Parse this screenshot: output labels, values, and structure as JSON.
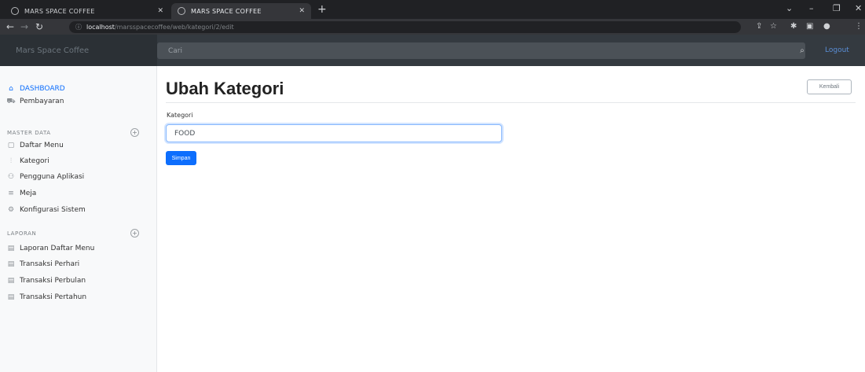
{
  "browser": {
    "tabs": [
      {
        "title": "MARS SPACE COFFEE",
        "active": false
      },
      {
        "title": "MARS SPACE COFFEE",
        "active": true
      }
    ],
    "url_host": "localhost",
    "url_path": "/marsspacecoffee/web/kategori/2/edit",
    "new_tab_symbol": "+",
    "window_controls": [
      "⌄",
      "–",
      "❐",
      "✕"
    ]
  },
  "navbar": {
    "brand": "Mars Space Coffee",
    "search_placeholder": "Cari",
    "signout": "Logout"
  },
  "sidebar": {
    "items": [
      {
        "label": "DASHBOARD",
        "icon": "home-icon",
        "active": true
      },
      {
        "label": "Pembayaran",
        "icon": "cart-icon",
        "active": false
      }
    ],
    "sections": [
      {
        "heading": "MASTER DATA",
        "items": [
          {
            "label": "Daftar Menu",
            "icon": "file-icon"
          },
          {
            "label": "Kategori",
            "icon": "bar-chart-icon"
          },
          {
            "label": "Pengguna Aplikasi",
            "icon": "users-icon"
          },
          {
            "label": "Meja",
            "icon": "layers-icon"
          },
          {
            "label": "Konfigurasi Sistem",
            "icon": "gear-icon"
          }
        ]
      },
      {
        "heading": "LAPORAN",
        "items": [
          {
            "label": "Laporan Daftar Menu",
            "icon": "document-icon"
          },
          {
            "label": "Transaksi Perhari",
            "icon": "document-icon"
          },
          {
            "label": "Transaksi Perbulan",
            "icon": "document-icon"
          },
          {
            "label": "Transaksi Pertahun",
            "icon": "document-icon"
          }
        ]
      }
    ]
  },
  "main": {
    "title": "Ubah Kategori",
    "back_label": "Kembali",
    "form": {
      "label": "Kategori",
      "value": "FOOD",
      "submit_label": "Simpan"
    }
  },
  "colors": {
    "primary": "#0d6efd",
    "navbar": "#343a40",
    "sidebar": "#f8f9fa"
  }
}
